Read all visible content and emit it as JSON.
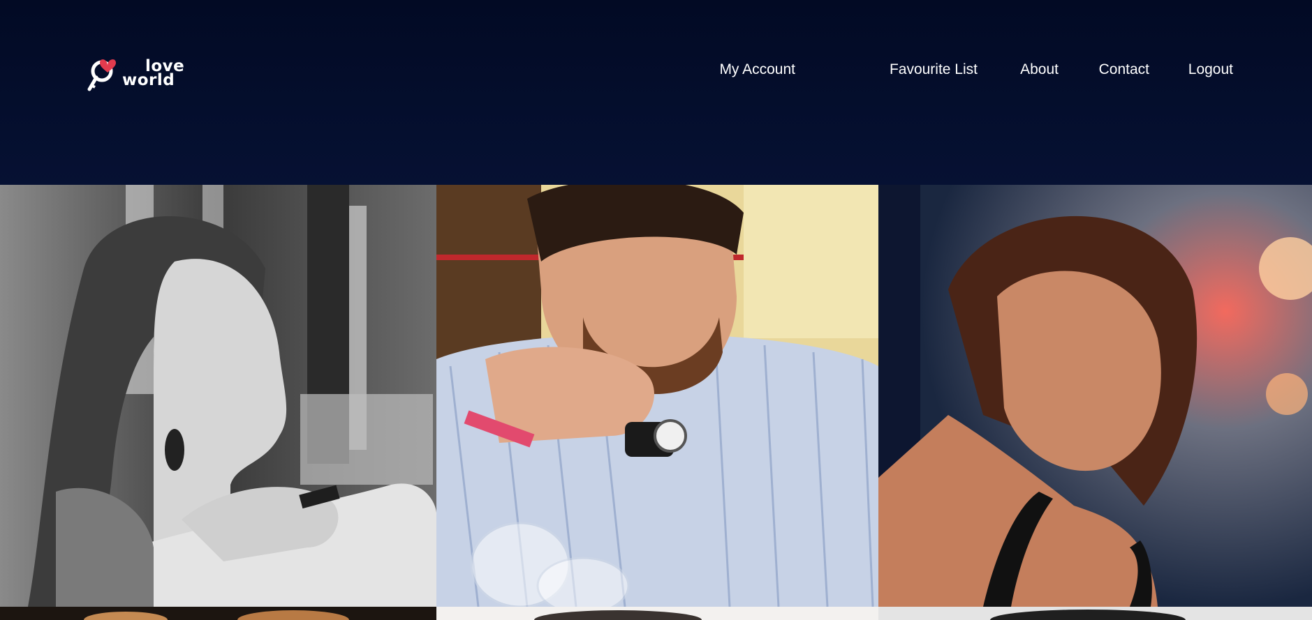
{
  "header": {
    "logo": {
      "line1": "love",
      "line2": "world",
      "icon": "key-heart-icon"
    },
    "nav": [
      {
        "label": "My Account"
      },
      {
        "label": "Favourite List"
      },
      {
        "label": "About"
      },
      {
        "label": "Contact"
      },
      {
        "label": "Logout"
      }
    ]
  },
  "gallery": {
    "photos": [
      {
        "subject": "woman-profile-bw"
      },
      {
        "subject": "man-striped-shirt"
      },
      {
        "subject": "woman-looking-down"
      },
      {
        "subject": "partial-photo-1"
      },
      {
        "subject": "partial-photo-2"
      },
      {
        "subject": "partial-photo-3"
      }
    ]
  },
  "colors": {
    "header_bg": "#020a24",
    "text": "#ffffff",
    "accent_heart": "#e23b4e"
  }
}
